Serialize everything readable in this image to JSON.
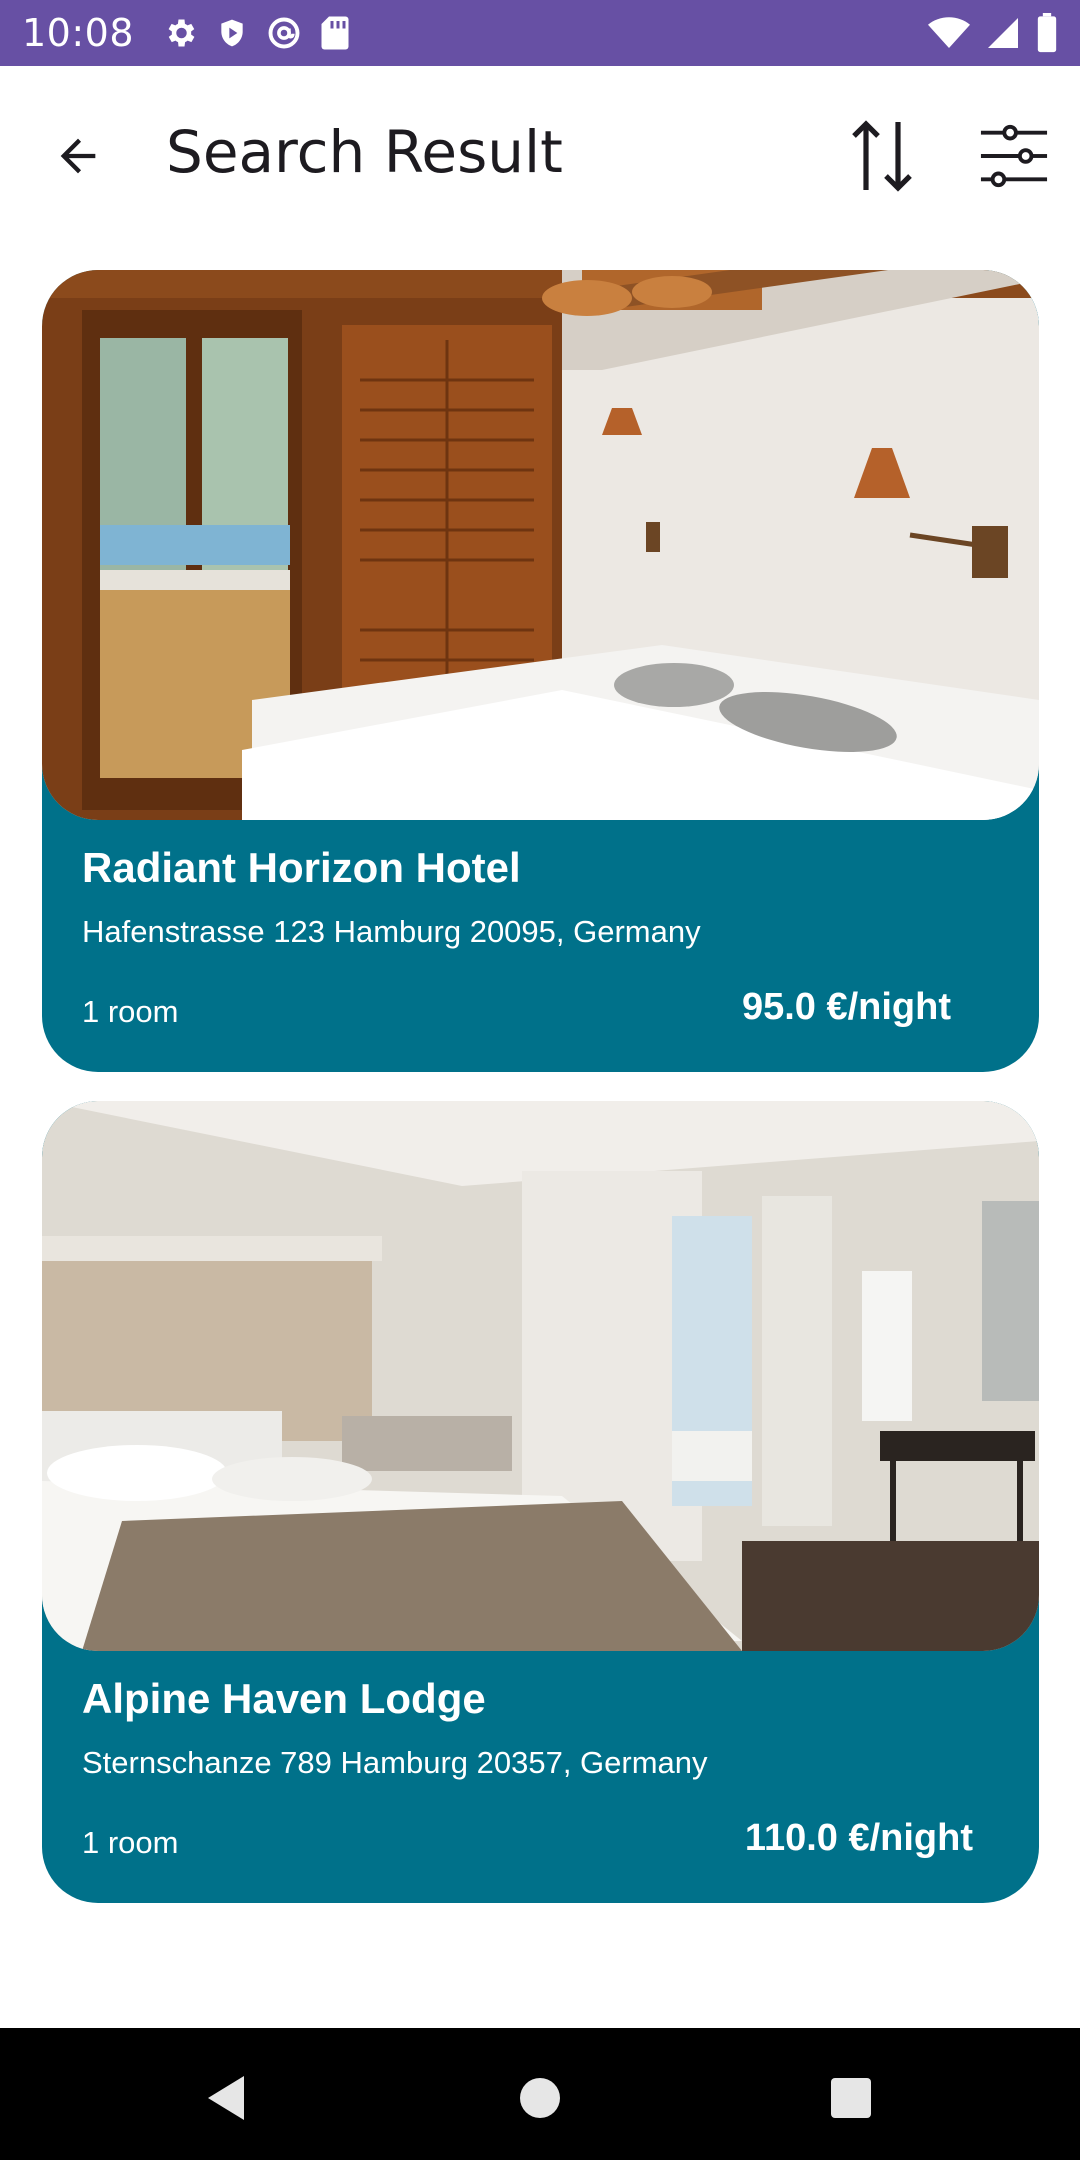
{
  "status_bar": {
    "time": "10:08",
    "icons_left": [
      "settings-icon",
      "shield-play-icon",
      "at-sign-icon",
      "sd-card-icon"
    ],
    "icons_right": [
      "wifi-icon",
      "signal-icon",
      "battery-icon"
    ],
    "background": "#6750a4"
  },
  "app_bar": {
    "title": "Search Result",
    "back_icon": "arrow-back-icon",
    "sort_icon": "sort-icon",
    "filter_icon": "tune-icon"
  },
  "results": [
    {
      "name": "Radiant Horizon Hotel",
      "address": "Hafenstrasse 123 Hamburg 20095, Germany",
      "rooms": "1 room",
      "price": "95.0 €/night"
    },
    {
      "name": "Alpine Haven Lodge",
      "address": "Sternschanze 789 Hamburg 20357, Germany",
      "rooms": "1 room",
      "price": "110.0 €/night"
    }
  ],
  "colors": {
    "card_background": "#00718a",
    "accent": "#6750a4"
  },
  "nav_bar": {
    "buttons": [
      "back-triangle-icon",
      "home-circle-icon",
      "recents-square-icon"
    ]
  }
}
